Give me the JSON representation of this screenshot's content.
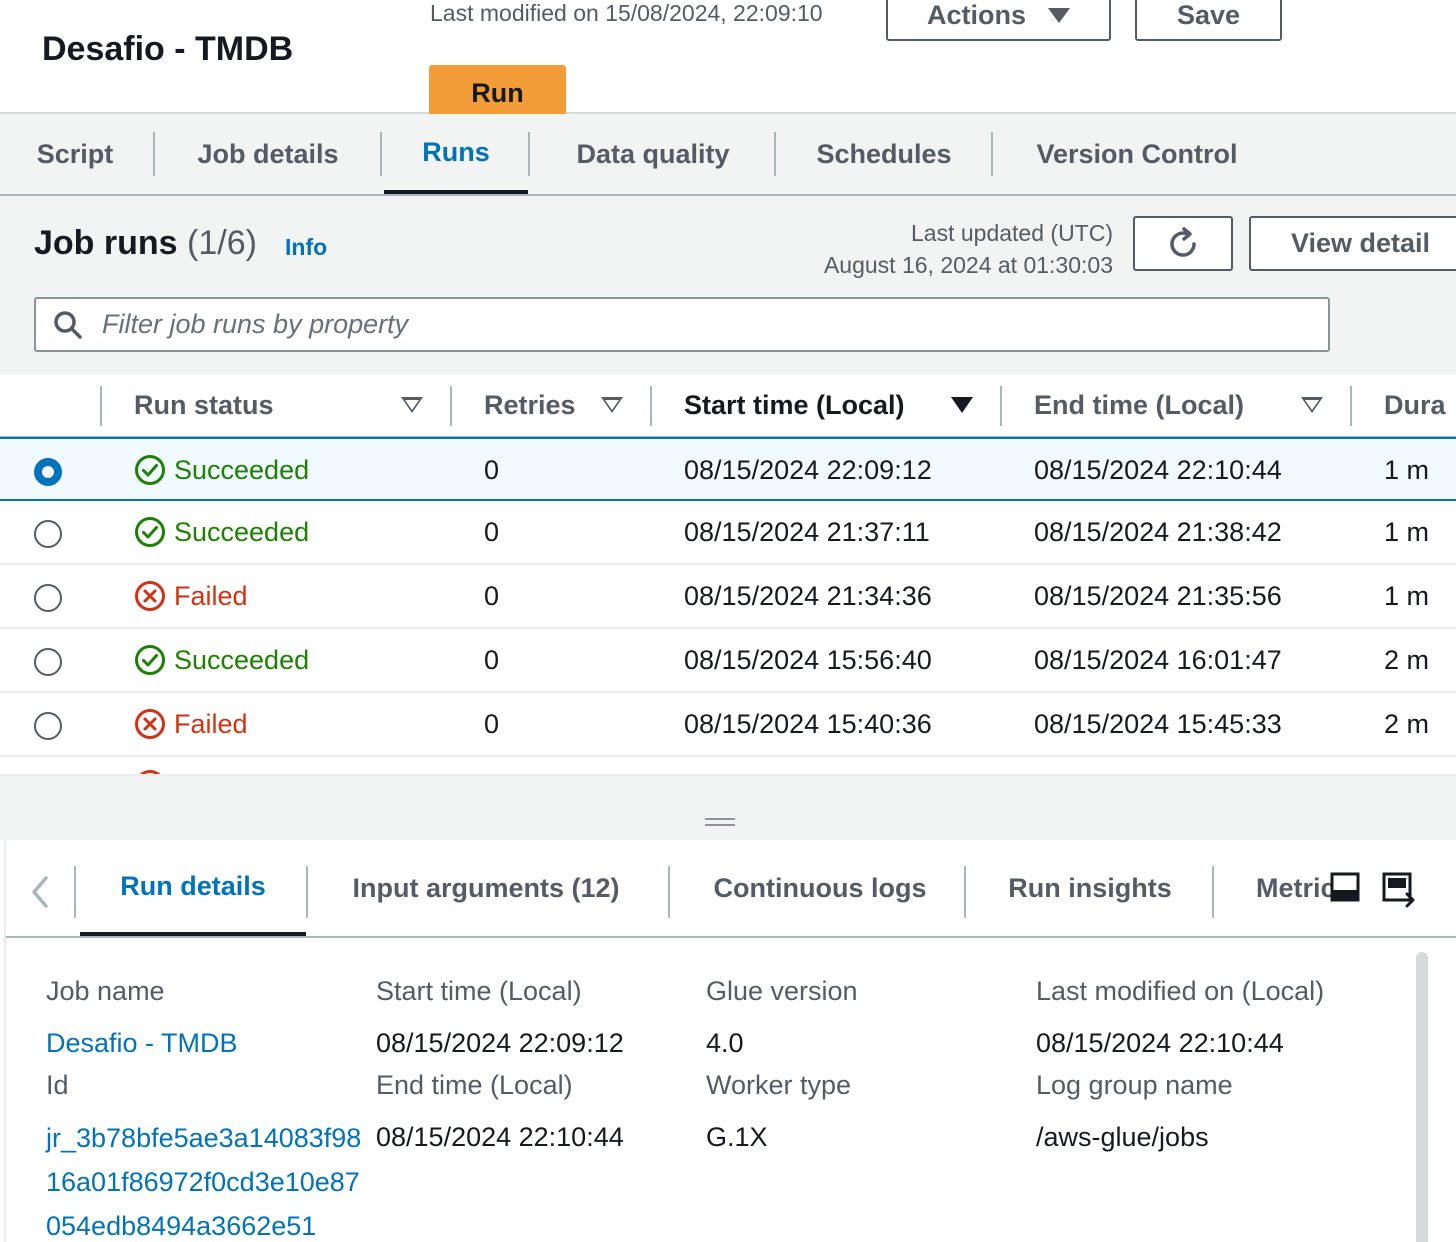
{
  "header": {
    "title": "Desafio - TMDB",
    "last_modified": "Last modified on 15/08/2024, 22:09:10",
    "actions_label": "Actions",
    "save_label": "Save",
    "run_label": "Run"
  },
  "tabs": [
    {
      "label": "Script",
      "active": false
    },
    {
      "label": "Job details",
      "active": false
    },
    {
      "label": "Runs",
      "active": true
    },
    {
      "label": "Data quality",
      "active": false
    },
    {
      "label": "Schedules",
      "active": false
    },
    {
      "label": "Version Control",
      "active": false
    }
  ],
  "job_runs": {
    "title": "Job runs",
    "count": "(1/6)",
    "info_label": "Info",
    "last_updated_label": "Last updated (UTC)",
    "last_updated_value": "August 16, 2024 at 01:30:03",
    "view_details_label": "View detail",
    "search_placeholder": "Filter job runs by property"
  },
  "table": {
    "columns": [
      "Run status",
      "Retries",
      "Start time (Local)",
      "End time (Local)",
      "Dura"
    ],
    "rows": [
      {
        "selected": true,
        "status": "Succeeded",
        "status_type": "success",
        "retries": "0",
        "start": "08/15/2024 22:09:12",
        "end": "08/15/2024 22:10:44",
        "duration": "1 m"
      },
      {
        "selected": false,
        "status": "Succeeded",
        "status_type": "success",
        "retries": "0",
        "start": "08/15/2024 21:37:11",
        "end": "08/15/2024 21:38:42",
        "duration": "1 m"
      },
      {
        "selected": false,
        "status": "Failed",
        "status_type": "failed",
        "retries": "0",
        "start": "08/15/2024 21:34:36",
        "end": "08/15/2024 21:35:56",
        "duration": "1 m"
      },
      {
        "selected": false,
        "status": "Succeeded",
        "status_type": "success",
        "retries": "0",
        "start": "08/15/2024 15:56:40",
        "end": "08/15/2024 16:01:47",
        "duration": "2 m"
      },
      {
        "selected": false,
        "status": "Failed",
        "status_type": "failed",
        "retries": "0",
        "start": "08/15/2024 15:40:36",
        "end": "08/15/2024 15:45:33",
        "duration": "2 m"
      }
    ]
  },
  "bottom_tabs": [
    {
      "label": "Run details",
      "active": true
    },
    {
      "label": "Input arguments (12)",
      "active": false
    },
    {
      "label": "Continuous logs",
      "active": false
    },
    {
      "label": "Run insights",
      "active": false
    },
    {
      "label": "Metrics",
      "active": false
    }
  ],
  "run_details": {
    "job_name_label": "Job name",
    "job_name_value": "Desafio - TMDB",
    "id_label": "Id",
    "id_value": "jr_3b78bfe5ae3a14083f9816a01f86972f0cd3e10e87054edb8494a3662e51",
    "start_time_label": "Start time (Local)",
    "start_time_value": "08/15/2024 22:09:12",
    "end_time_label": "End time (Local)",
    "end_time_value": "08/15/2024 22:10:44",
    "glue_version_label": "Glue version",
    "glue_version_value": "4.0",
    "worker_type_label": "Worker type",
    "worker_type_value": "G.1X",
    "last_modified_label": "Last modified on (Local)",
    "last_modified_value": "08/15/2024 22:10:44",
    "log_group_label": "Log group name",
    "log_group_value": "/aws-glue/jobs"
  },
  "colors": {
    "accent": "#0073bb",
    "run_button": "#f29d38",
    "success": "#1d8102",
    "failed": "#d13212"
  }
}
